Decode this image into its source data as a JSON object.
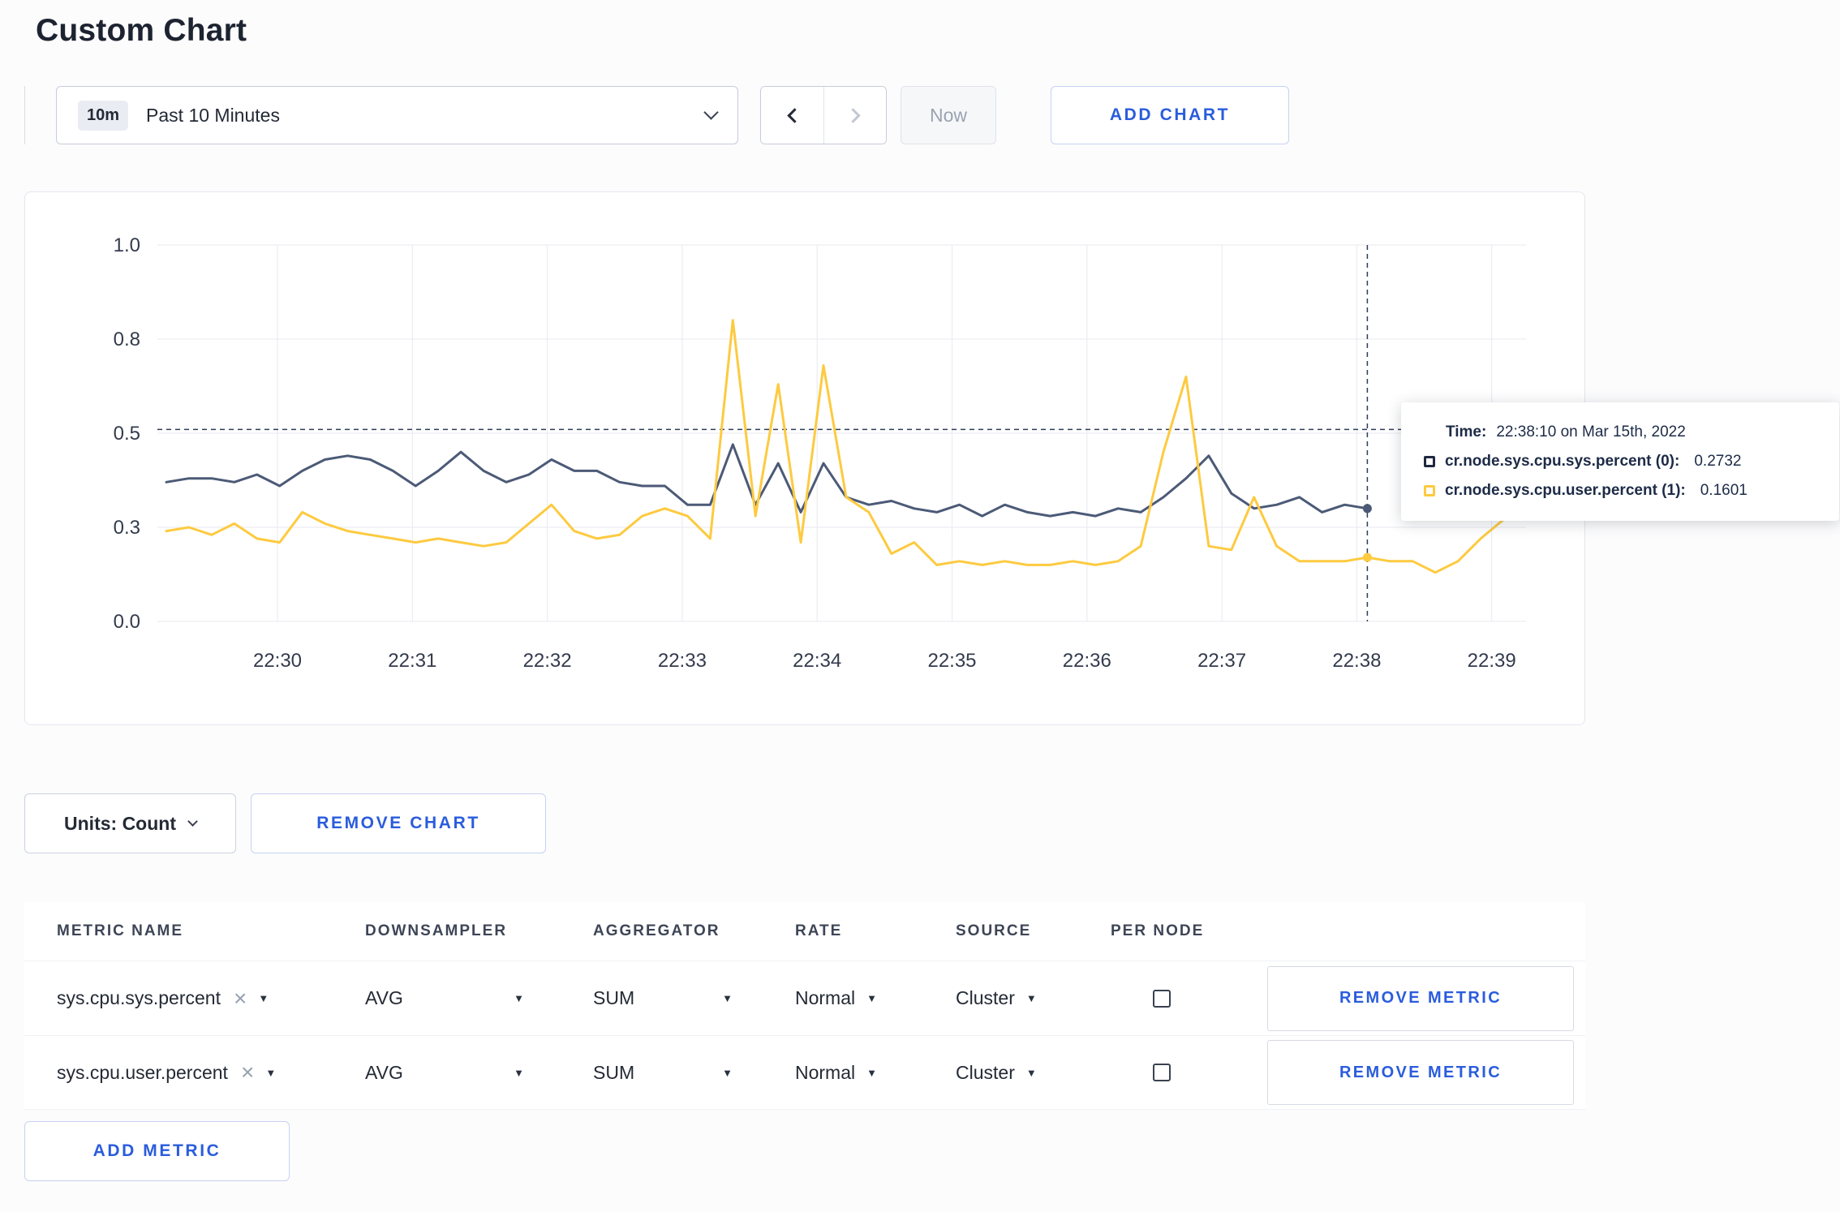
{
  "page": {
    "title": "Custom Chart"
  },
  "icons": {
    "caret_down": "▼",
    "close": "×"
  },
  "toolbar": {
    "range_badge": "10m",
    "range_label": "Past 10 Minutes",
    "now_label": "Now",
    "add_chart_label": "ADD CHART"
  },
  "chart_data": {
    "type": "line",
    "title": "",
    "xlabel": "",
    "ylabel": "",
    "ylim": [
      0,
      1
    ],
    "grid": true,
    "x_ticks": [
      "22:30",
      "22:31",
      "22:32",
      "22:33",
      "22:34",
      "22:35",
      "22:36",
      "22:37",
      "22:38",
      "22:39"
    ],
    "y_ticks": [
      "1.0",
      "0.8",
      "0.5",
      "0.3",
      "0.0"
    ],
    "y_tick_values": [
      1.0,
      0.75,
      0.5,
      0.25,
      0.0
    ],
    "crosshair": {
      "index": 53,
      "time": "22:38:10",
      "hline_value": 0.51
    },
    "series": [
      {
        "name": "cr.node.sys.cpu.sys.percent",
        "color": "#4c5a77",
        "values": [
          0.37,
          0.38,
          0.38,
          0.37,
          0.39,
          0.36,
          0.4,
          0.43,
          0.44,
          0.43,
          0.4,
          0.36,
          0.4,
          0.45,
          0.4,
          0.37,
          0.39,
          0.43,
          0.4,
          0.4,
          0.37,
          0.36,
          0.36,
          0.31,
          0.31,
          0.47,
          0.31,
          0.42,
          0.29,
          0.42,
          0.33,
          0.31,
          0.32,
          0.3,
          0.29,
          0.31,
          0.28,
          0.31,
          0.29,
          0.28,
          0.29,
          0.28,
          0.3,
          0.29,
          0.33,
          0.38,
          0.44,
          0.34,
          0.3,
          0.31,
          0.33,
          0.29,
          0.31,
          0.3,
          null,
          null,
          null,
          null,
          null,
          null
        ]
      },
      {
        "name": "cr.node.sys.cpu.user.percent",
        "color": "#fdca40",
        "values": [
          0.24,
          0.25,
          0.23,
          0.26,
          0.22,
          0.21,
          0.29,
          0.26,
          0.24,
          0.23,
          0.22,
          0.21,
          0.22,
          0.21,
          0.2,
          0.21,
          0.26,
          0.31,
          0.24,
          0.22,
          0.23,
          0.28,
          0.3,
          0.28,
          0.22,
          0.8,
          0.28,
          0.63,
          0.21,
          0.68,
          0.33,
          0.29,
          0.18,
          0.21,
          0.15,
          0.16,
          0.15,
          0.16,
          0.15,
          0.15,
          0.16,
          0.15,
          0.16,
          0.2,
          0.45,
          0.65,
          0.2,
          0.19,
          0.33,
          0.2,
          0.16,
          0.16,
          0.16,
          0.17,
          0.16,
          0.16,
          0.13,
          0.16,
          0.22,
          0.27
        ]
      }
    ]
  },
  "tooltip": {
    "time_label": "Time:",
    "time_value": "22:38:10 on Mar 15th, 2022",
    "series": [
      {
        "label": "cr.node.sys.cpu.sys.percent (0):",
        "value": "0.2732",
        "color": "#1f2940"
      },
      {
        "label": "cr.node.sys.cpu.user.percent (1):",
        "value": "0.1601",
        "color": "#fdca40"
      }
    ]
  },
  "units": {
    "label": "Units: Count",
    "remove_chart_label": "REMOVE CHART"
  },
  "metrics_table": {
    "headers": [
      "METRIC NAME",
      "DOWNSAMPLER",
      "AGGREGATOR",
      "RATE",
      "SOURCE",
      "PER NODE"
    ],
    "rows": [
      {
        "metric": "sys.cpu.sys.percent",
        "downsampler": "AVG",
        "aggregator": "SUM",
        "rate": "Normal",
        "source": "Cluster",
        "per_node": false,
        "remove_label": "REMOVE METRIC"
      },
      {
        "metric": "sys.cpu.user.percent",
        "downsampler": "AVG",
        "aggregator": "SUM",
        "rate": "Normal",
        "source": "Cluster",
        "per_node": false,
        "remove_label": "REMOVE METRIC"
      }
    ],
    "add_metric_label": "ADD METRIC"
  }
}
